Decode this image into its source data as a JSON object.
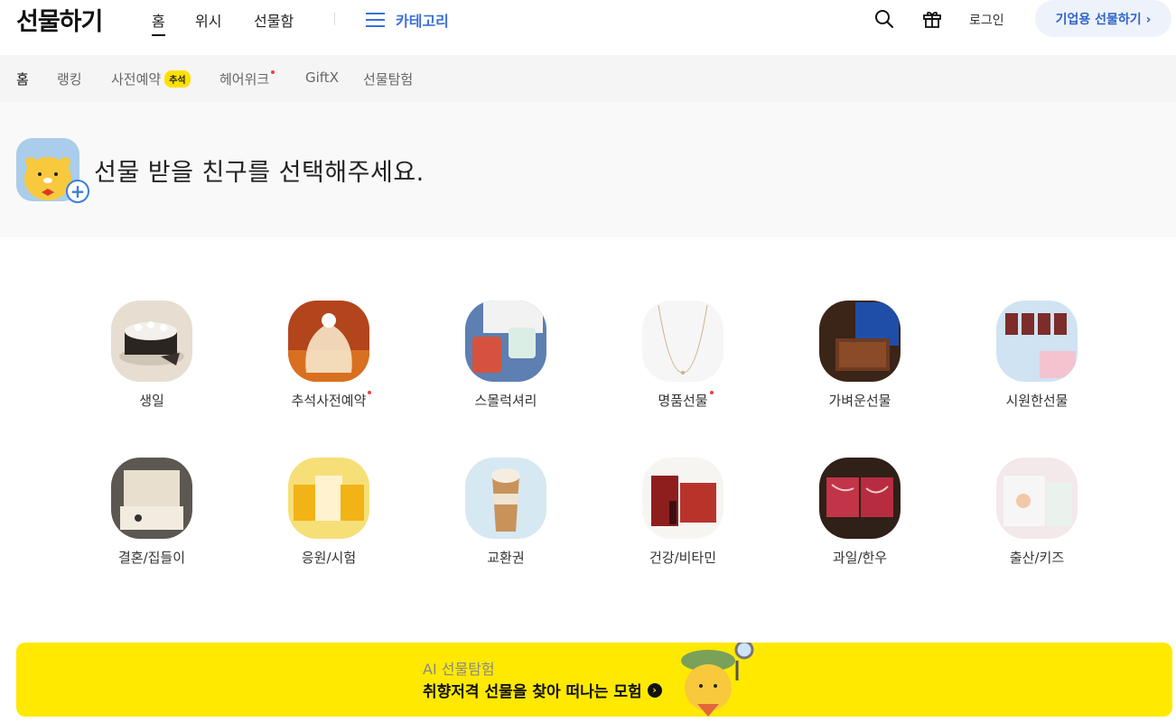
{
  "header": {
    "logo": "선물하기",
    "nav": [
      "홈",
      "위시",
      "선물함"
    ],
    "category_label": "카테고리",
    "login_label": "로그인",
    "biz_label": "기업용 선물하기 ›"
  },
  "subnav": {
    "home": "홈",
    "ranking": "랭킹",
    "preorder": "사전예약",
    "preorder_badge": "추석",
    "hairwig": "헤어위크",
    "giftx": "GiftX",
    "explore": "선물탐험"
  },
  "friend": {
    "prompt": "선물 받을 친구를 선택해주세요."
  },
  "categories": [
    {
      "label": "생일",
      "dot": false,
      "icon": "birthday-cake-image"
    },
    {
      "label": "추석사전예약",
      "dot": true,
      "icon": "wrapped-gift-image"
    },
    {
      "label": "스몰럭셔리",
      "dot": false,
      "icon": "mug-image"
    },
    {
      "label": "명품선물",
      "dot": true,
      "icon": "necklace-image"
    },
    {
      "label": "가벼운선물",
      "dot": false,
      "icon": "chocolate-box-image"
    },
    {
      "label": "시원한선물",
      "dot": false,
      "icon": "icecream-cups-image"
    },
    {
      "label": "결혼/집들이",
      "dot": false,
      "icon": "record-player-image"
    },
    {
      "label": "응원/시험",
      "dot": false,
      "icon": "snack-boxes-image"
    },
    {
      "label": "교환권",
      "dot": false,
      "icon": "latte-image"
    },
    {
      "label": "건강/비타민",
      "dot": false,
      "icon": "red-ginseng-image"
    },
    {
      "label": "과일/한우",
      "dot": false,
      "icon": "beef-image"
    },
    {
      "label": "출산/키즈",
      "dot": false,
      "icon": "diapers-image"
    }
  ],
  "banner": {
    "subtitle": "AI 선물탐험",
    "title": "취향저격 선물을 찾아 떠나는 모험"
  },
  "colors": {
    "accent_blue": "#3a6fd8",
    "banner_yellow": "#ffe900",
    "badge_yellow": "#ffe000",
    "dot_red": "#f0403c"
  }
}
